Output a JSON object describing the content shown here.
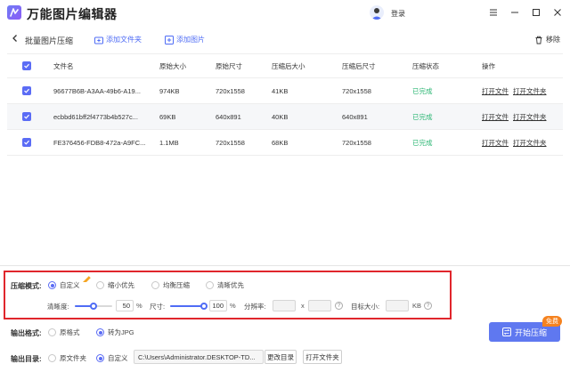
{
  "app": {
    "title": "万能图片编辑器",
    "login": "登录"
  },
  "toolbar": {
    "page_title": "批量图片压缩",
    "add_folder": "添加文件夹",
    "add_image": "添加图片",
    "remove": "移除"
  },
  "table": {
    "headers": [
      "文件名",
      "原始大小",
      "原始尺寸",
      "压缩后大小",
      "压缩后尺寸",
      "压缩状态",
      "操作"
    ],
    "rows": [
      {
        "name": "96677B6B-A3AA-49b6-A19...",
        "orig_size": "974KB",
        "orig_dim": "720x1558",
        "new_size": "41KB",
        "new_dim": "720x1558",
        "status": "已完成",
        "open_file": "打开文件",
        "open_folder": "打开文件夹"
      },
      {
        "name": "ecbbd61bff2f4773b4b527c...",
        "orig_size": "69KB",
        "orig_dim": "640x891",
        "new_size": "40KB",
        "new_dim": "640x891",
        "status": "已完成",
        "open_file": "打开文件",
        "open_folder": "打开文件夹"
      },
      {
        "name": "FE376456-FDB8-472a-A9FC...",
        "orig_size": "1.1MB",
        "orig_dim": "720x1558",
        "new_size": "68KB",
        "new_dim": "720x1558",
        "status": "已完成",
        "open_file": "打开文件",
        "open_folder": "打开文件夹"
      }
    ]
  },
  "compress": {
    "mode_label": "压缩模式:",
    "modes": [
      "自定义",
      "缩小优先",
      "均衡压缩",
      "清晰优先"
    ],
    "selected_mode": "自定义",
    "clarity_label": "清晰度:",
    "clarity_value": "50",
    "clarity_percent": 50,
    "size_label": "尺寸:",
    "size_value": "100",
    "size_percent": 100,
    "percent_unit": "%",
    "resolution_label": "分辨率:",
    "resolution_x": "x",
    "target_label": "目标大小:",
    "target_unit": "KB"
  },
  "output": {
    "format_label": "输出格式:",
    "formats": [
      "原格式",
      "转为JPG"
    ],
    "selected_format": "转为JPG",
    "dir_label": "输出目录:",
    "dir_options": [
      "原文件夹",
      "自定义"
    ],
    "selected_dir": "自定义",
    "path": "C:\\Users\\Administrator.DESKTOP-TD...",
    "change_dir": "更改目录",
    "open_folder": "打开文件夹"
  },
  "start": {
    "label": "开始压缩",
    "badge": "免费"
  },
  "colors": {
    "accent": "#5b6cf5",
    "success": "#2bb673",
    "highlight": "#e0262c",
    "badge": "#f5821f"
  }
}
